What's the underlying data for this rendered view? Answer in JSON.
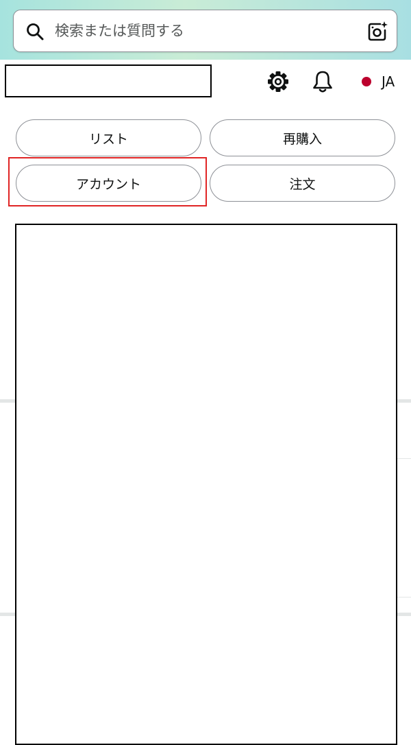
{
  "search": {
    "placeholder": "検索または質問する",
    "search_icon": "search-icon",
    "camera_icon": "camera-sparkle-icon"
  },
  "header": {
    "settings_icon": "gear-icon",
    "notifications_icon": "bell-icon",
    "language_flag": "japan-flag-icon",
    "language_code": "JA"
  },
  "quick_links": [
    {
      "label": "リスト"
    },
    {
      "label": "再購入"
    },
    {
      "label": "アカウント"
    },
    {
      "label": "注文"
    }
  ],
  "colors": {
    "top_bar_gradient": [
      "#a6e3de",
      "#c9ecd6",
      "#a8dfe2"
    ],
    "highlight": "#e02424",
    "pill_border": "#8d9096",
    "flag_red": "#bc002d"
  }
}
